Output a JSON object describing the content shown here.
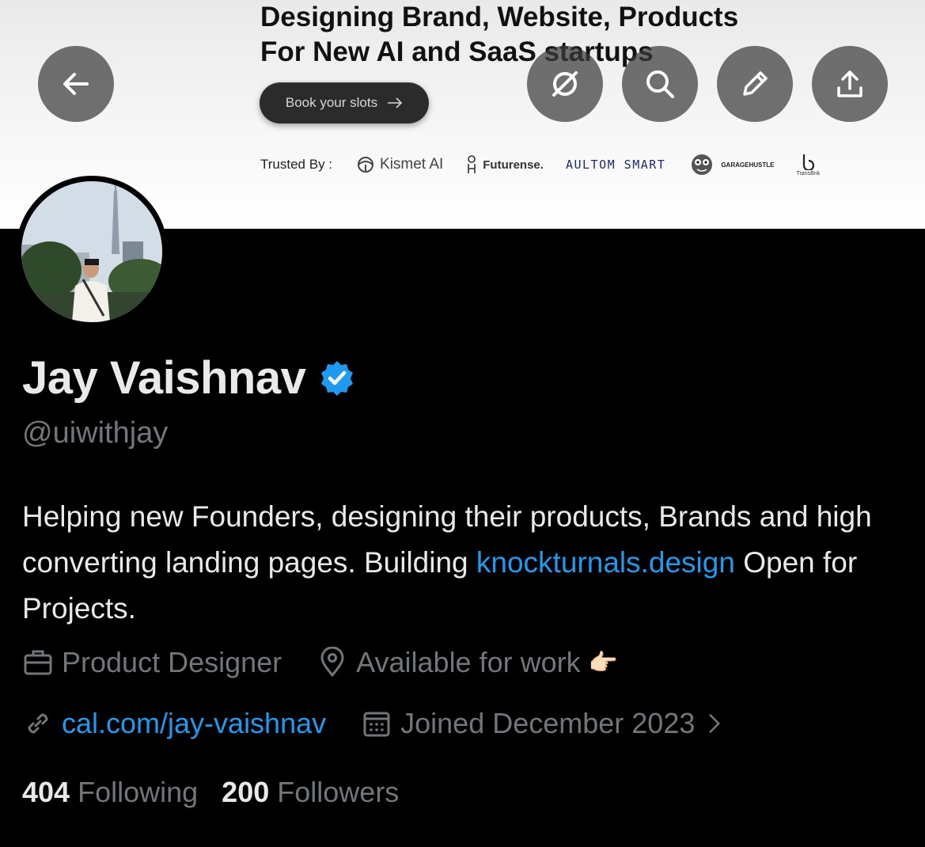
{
  "banner": {
    "headline_line1": "Designing Brand, Website, Products",
    "headline_line2": "For New AI and SaaS startups",
    "cta_label": "Book your slots",
    "trusted_label": "Trusted By :",
    "logos": {
      "kismet": "Kismet AI",
      "futurense": "Futurense.",
      "aultom": "AULTOM SMART",
      "garage": "GARAGEHUSTLE",
      "transbnk": "TransBnk"
    }
  },
  "toolbar": {
    "icons": [
      "arrow-left-icon",
      "grok-icon",
      "search-icon",
      "edit-icon",
      "share-icon"
    ]
  },
  "profile": {
    "name": "Jay Vaishnav",
    "handle": "@uiwithjay",
    "bio_text_1": "Helping new Founders, designing their products, Brands and high converting landing pages. Building",
    "bio_link": "knockturnals.design",
    "bio_text_2": " Open for Projects.",
    "profession": "Product Designer",
    "location": "Available for work",
    "location_emoji": "👉🏻",
    "website": "cal.com/jay-vaishnav",
    "joined": "Joined December 2023",
    "following_count": "404",
    "following_label": "Following",
    "followers_count": "200",
    "followers_label": "Followers"
  },
  "colors": {
    "background": "#000000",
    "text_primary": "#e7e9ea",
    "text_secondary": "#71767b",
    "link": "#1d9bf0",
    "verified": "#1d9bf0"
  }
}
